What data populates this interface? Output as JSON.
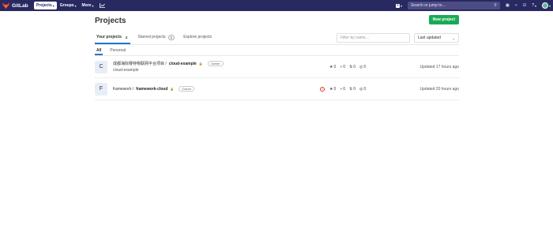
{
  "topbar": {
    "brand": "GitLab",
    "nav": [
      {
        "label": "Projects",
        "active": true
      },
      {
        "label": "Groups",
        "active": false
      },
      {
        "label": "More",
        "active": false
      }
    ],
    "search_placeholder": "Search or jump to…"
  },
  "page": {
    "title": "Projects",
    "new_project_label": "New project"
  },
  "tabs": [
    {
      "label": "Your projects",
      "count": "2"
    },
    {
      "label": "Starred projects",
      "count": "0"
    },
    {
      "label": "Explore projects"
    }
  ],
  "filter": {
    "placeholder": "Filter by name...",
    "sort_label": "Last updated"
  },
  "subtabs": [
    "All",
    "Personal"
  ],
  "projects": [
    {
      "avatar": "C",
      "namespace": "成都海际赛特物联网平台项目 /",
      "name": "cloud-example",
      "role": "Owner",
      "description": "cloud-example",
      "stars": "0",
      "forks": "0",
      "merge_requests": "0",
      "issues": "0",
      "updated": "Updated 17 hours ago"
    },
    {
      "avatar": "F",
      "namespace": "framework /",
      "name": "framework-cloud",
      "role": "Owner",
      "description": "",
      "stars": "0",
      "forks": "0",
      "merge_requests": "0",
      "issues": "0",
      "updated": "Updated 20 hours ago"
    }
  ]
}
